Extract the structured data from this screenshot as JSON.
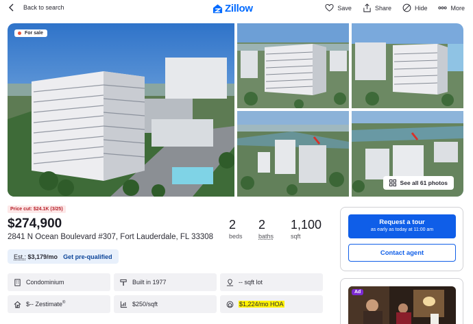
{
  "topbar": {
    "back_label": "Back to search",
    "logo_text": "Zillow",
    "actions": [
      {
        "label": "Save",
        "icon": "heart-icon"
      },
      {
        "label": "Share",
        "icon": "share-icon"
      },
      {
        "label": "Hide",
        "icon": "hide-icon"
      },
      {
        "label": "More",
        "icon": "more-icon"
      }
    ]
  },
  "gallery": {
    "status_label": "For sale",
    "see_all_label": "See all 61 photos"
  },
  "listing": {
    "price_cut": "Price cut: $24.1K (3/25)",
    "price": "$274,900",
    "address": "2841 N Ocean Boulevard #307, Fort Lauderdale, FL 33308",
    "beds": {
      "value": "2",
      "label": "beds"
    },
    "baths": {
      "value": "2",
      "label": "baths"
    },
    "sqft": {
      "value": "1,100",
      "label": "sqft"
    },
    "est_prefix": "Est.:",
    "est_amount": "$3,179/mo",
    "prequal_label": "Get pre-qualified"
  },
  "facts": [
    {
      "icon": "building-icon",
      "text": "Condominium"
    },
    {
      "icon": "hammer-icon",
      "text": "Built in 1977"
    },
    {
      "icon": "lot-icon",
      "text": "-- sqft lot"
    },
    {
      "icon": "zestimate-icon",
      "text": "$-- Zestimate",
      "sup": "®"
    },
    {
      "icon": "price-per-sqft-icon",
      "text": "$250/sqft"
    },
    {
      "icon": "hoa-icon",
      "text": "$1,224/mo HOA",
      "highlighted": true
    }
  ],
  "panel": {
    "tour_label": "Request a tour",
    "tour_sub": "as early as today at 11:00 am",
    "agent_label": "Contact agent"
  },
  "ad": {
    "badge": "Ad"
  },
  "colors": {
    "brand": "#006aff",
    "primary_button": "#0f5ee8",
    "price_cut_bg": "#fde8e8",
    "price_cut_text": "#b6212a",
    "highlight": "#fff200"
  }
}
